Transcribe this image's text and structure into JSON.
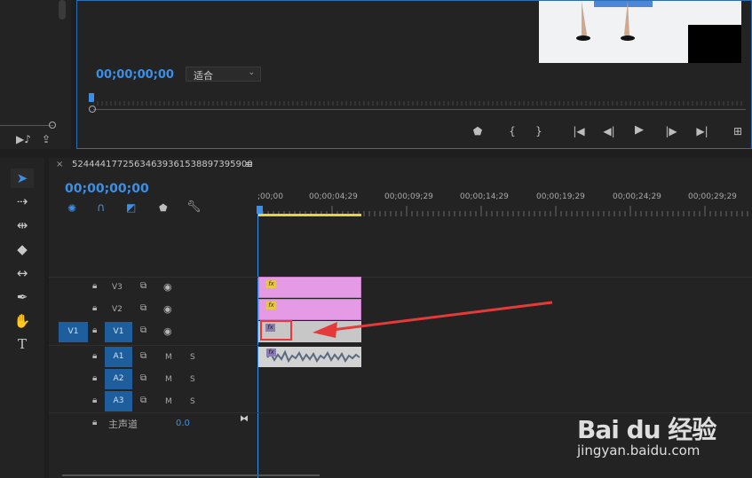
{
  "program_monitor": {
    "timecode": "00;00;00;00",
    "zoom_select": "适合"
  },
  "timeline": {
    "sequence_name": "524444177256346393615388973959​00",
    "timecode": "00;00;00;00",
    "ruler_labels": [
      ";00;00",
      "00;00;04;29",
      "00;00;09;29",
      "00;00;14;29",
      "00;00;19;29",
      "00;00;24;29",
      "00;00;29;29"
    ],
    "tracks": {
      "v3": "V3",
      "v2": "V2",
      "v1": "V1",
      "v1_source": "V1",
      "a1": "A1",
      "a2": "A2",
      "a3": "A3",
      "mute": "M",
      "solo": "S",
      "master_label": "主声道",
      "master_value": "0.0"
    },
    "fx": "fx"
  },
  "watermark": {
    "brand": "Bai du 经验",
    "url": "jingyan.baidu.com"
  },
  "colors": {
    "accent": "#3b8fe6",
    "clip_pink": "#e59ae5",
    "highlight_red": "#e53a3a"
  }
}
